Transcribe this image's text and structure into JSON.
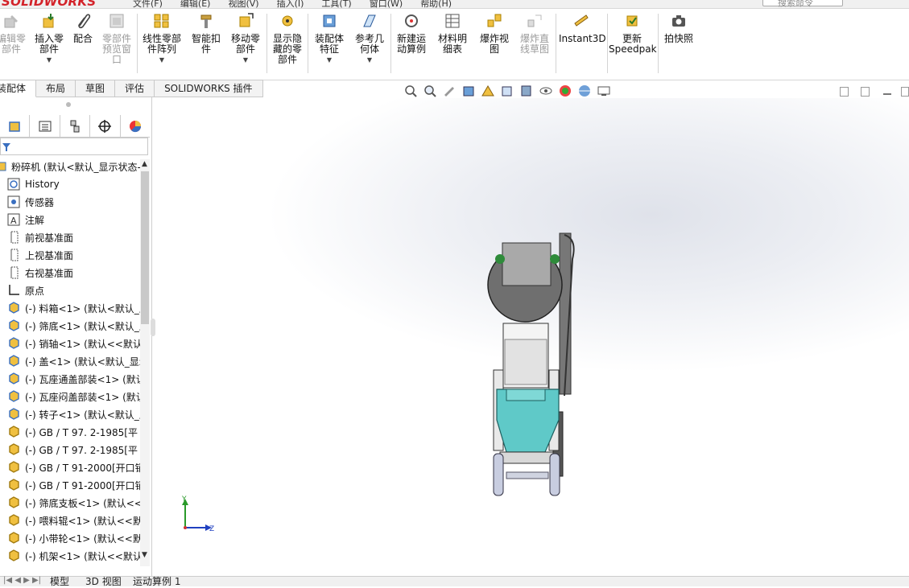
{
  "app": {
    "logo": "SOLIDWORKS",
    "search_placeholder": "搜索命令",
    "menus": [
      "文件(F)",
      "编辑(E)",
      "视图(V)",
      "插入(I)",
      "工具(T)",
      "窗口(W)",
      "帮助(H)"
    ]
  },
  "ribbon": {
    "edit_component": "编辑零\n部件",
    "insert_component": "插入零\n部件",
    "mate": "配合",
    "component_preview": "零部件\n预览窗\n口",
    "linear_pattern": "线性零部\n件阵列",
    "smart_fasteners": "智能扣\n件",
    "move_component": "移动零\n部件",
    "show_hidden": "显示隐\n藏的零\n部件",
    "assembly_features": "装配体\n特征",
    "reference_geometry": "参考几\n何体",
    "new_motion_study": "新建运\n动算例",
    "bom": "材料明\n细表",
    "exploded_view": "爆炸视\n图",
    "explode_line_sketch": "爆炸直\n线草图",
    "instant3d": "Instant3D",
    "update_speedpak": "更新\nSpeedpak",
    "take_snapshot": "拍快照"
  },
  "command_tabs": [
    "装配体",
    "布局",
    "草图",
    "评估",
    "SOLIDWORKS 插件"
  ],
  "tree": {
    "root": "粉碎机 (默认<默认_显示状态-",
    "items": [
      {
        "label": "History",
        "icon": "history-icon"
      },
      {
        "label": "传感器",
        "icon": "sensor-icon"
      },
      {
        "label": "注解",
        "icon": "annotation-icon"
      },
      {
        "label": "前视基准面",
        "icon": "plane-icon"
      },
      {
        "label": "上视基准面",
        "icon": "plane-icon"
      },
      {
        "label": "右视基准面",
        "icon": "plane-icon"
      },
      {
        "label": "原点",
        "icon": "origin-icon"
      },
      {
        "label": "(-) 料箱<1> (默认<默认_显",
        "icon": "part-icon"
      },
      {
        "label": "(-) 筛底<1> (默认<默认_显",
        "icon": "part-icon"
      },
      {
        "label": "(-) 销轴<1> (默认<<默认",
        "icon": "part-icon"
      },
      {
        "label": "(-) 盖<1> (默认<默认_显示",
        "icon": "part-icon"
      },
      {
        "label": "(-) 瓦座通盖部装<1> (默认",
        "icon": "part-icon"
      },
      {
        "label": "(-) 瓦座闷盖部装<1> (默认",
        "icon": "part-icon"
      },
      {
        "label": "(-) 转子<1> (默认<默认_显",
        "icon": "part-icon"
      },
      {
        "label": "(-) GB / T 97. 2-1985[平",
        "icon": "std-part-icon"
      },
      {
        "label": "(-) GB / T 97. 2-1985[平",
        "icon": "std-part-icon"
      },
      {
        "label": "(-) GB / T 91-2000[开口销",
        "icon": "std-part-icon"
      },
      {
        "label": "(-) GB / T 91-2000[开口销",
        "icon": "std-part-icon"
      },
      {
        "label": "(-) 筛底支板<1> (默认<<",
        "icon": "std-part-icon"
      },
      {
        "label": "(-) 喂料辊<1> (默认<<默",
        "icon": "std-part-icon"
      },
      {
        "label": "(-) 小带轮<1> (默认<<默",
        "icon": "std-part-icon"
      },
      {
        "label": "(-) 机架<1> (默认<<默认",
        "icon": "std-part-icon"
      }
    ]
  },
  "bottom_tabs": [
    "模型",
    "3D 视图",
    "运动算例 1"
  ],
  "triad": {
    "y": "Y",
    "z": "Z"
  },
  "colors": {
    "accent_blue": "#1f5fbf",
    "hopper_teal": "#5fc9c8",
    "logo_red": "#d3232a"
  }
}
